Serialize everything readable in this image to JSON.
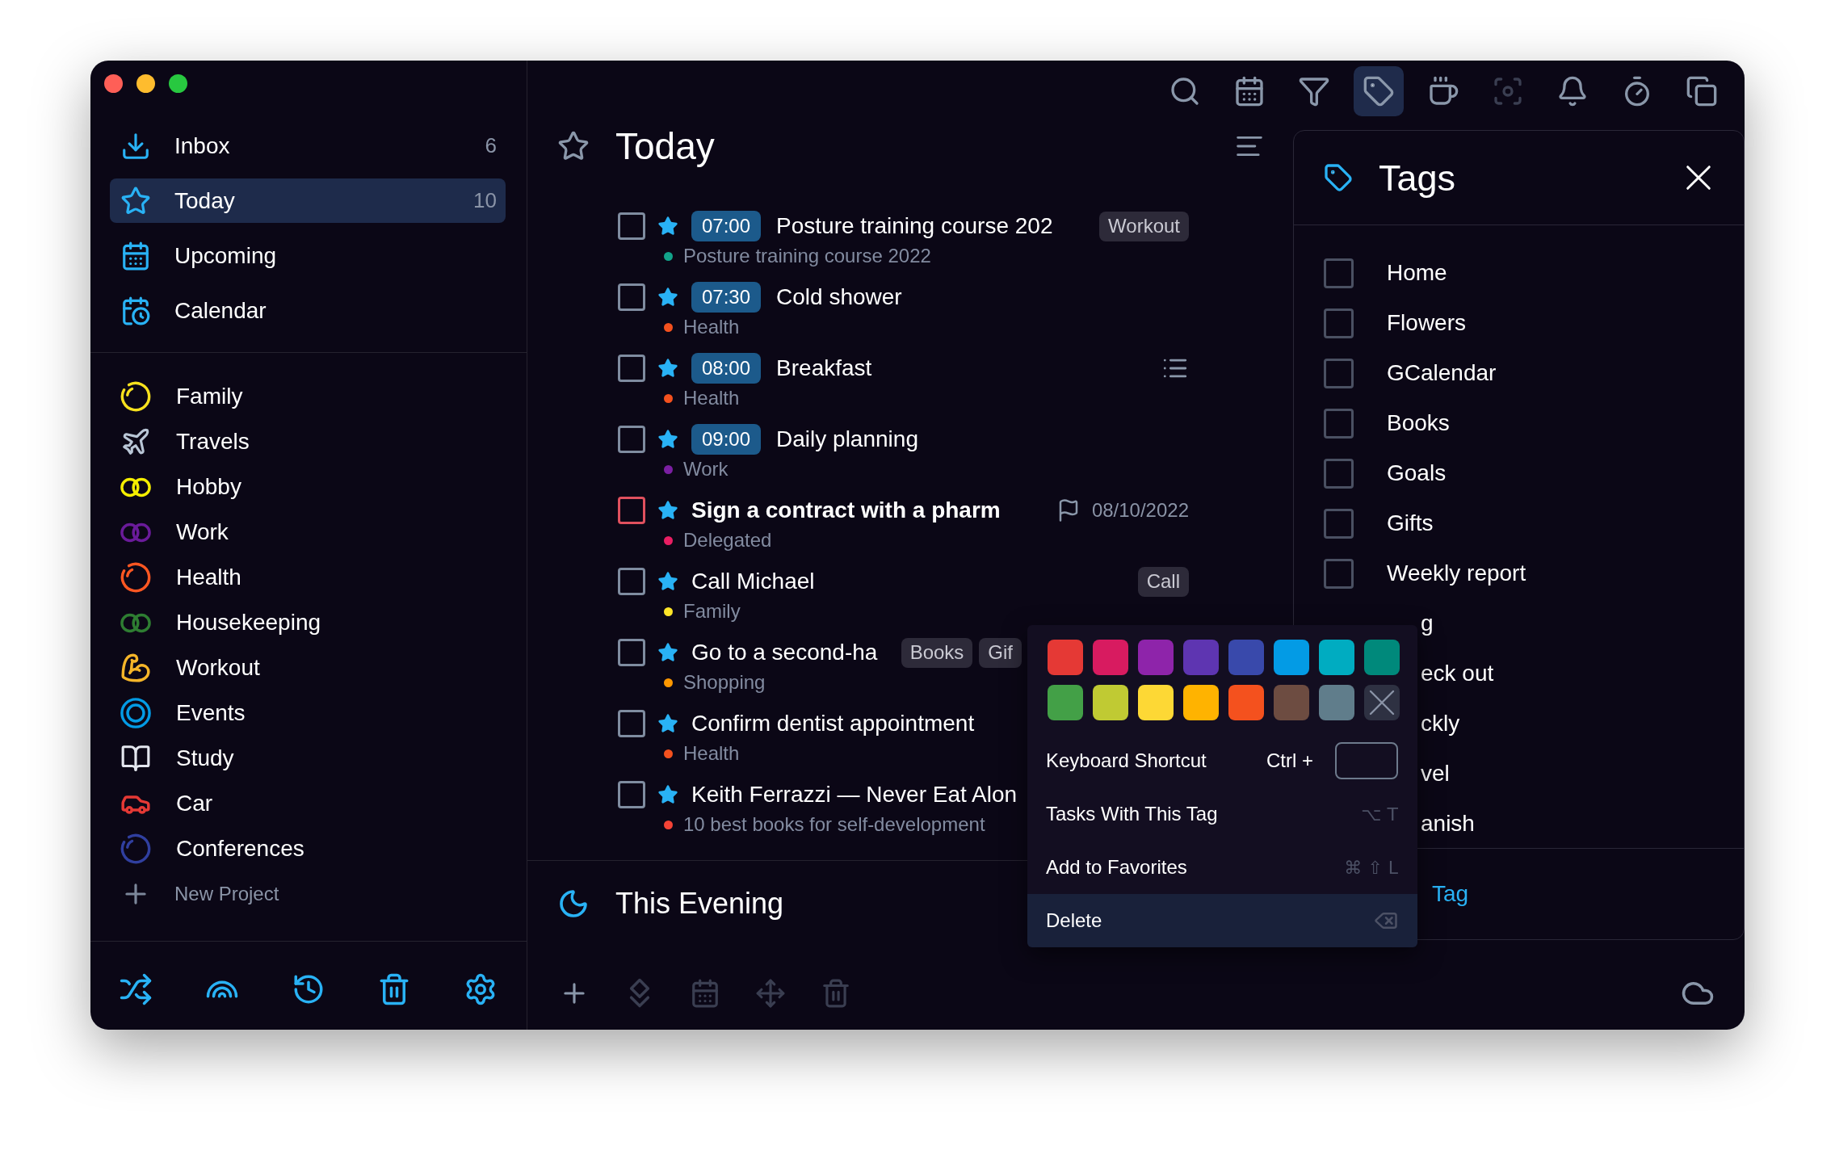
{
  "sidebar": {
    "nav": [
      {
        "label": "Inbox",
        "count": "6",
        "selected": false
      },
      {
        "label": "Today",
        "count": "10",
        "selected": true
      },
      {
        "label": "Upcoming",
        "selected": false
      },
      {
        "label": "Calendar",
        "selected": false
      }
    ],
    "projects": [
      {
        "label": "Family",
        "kind": "ring",
        "color": "#f7e11e"
      },
      {
        "label": "Travels",
        "kind": "plane"
      },
      {
        "label": "Hobby",
        "kind": "linked-rings",
        "color": "#f5ee00"
      },
      {
        "label": "Work",
        "kind": "linked-rings",
        "color": "#6a1b9a"
      },
      {
        "label": "Health",
        "kind": "ring",
        "color": "#ff5722"
      },
      {
        "label": "Housekeeping",
        "kind": "linked-rings",
        "color": "#2e7d32"
      },
      {
        "label": "Workout",
        "kind": "muscle"
      },
      {
        "label": "Events",
        "kind": "double-ring",
        "color": "#039be5"
      },
      {
        "label": "Study",
        "kind": "book"
      },
      {
        "label": "Car",
        "kind": "car"
      },
      {
        "label": "Conferences",
        "kind": "ring",
        "color": "#303f9f"
      }
    ],
    "new_project": "New Project"
  },
  "toolbar": [
    {
      "selected": false,
      "disabled": false
    },
    {
      "selected": false,
      "disabled": false
    },
    {
      "selected": false,
      "disabled": false
    },
    {
      "selected": true,
      "disabled": false
    },
    {
      "selected": false,
      "disabled": false
    },
    {
      "selected": false,
      "disabled": true
    },
    {
      "selected": false,
      "disabled": false
    },
    {
      "selected": false,
      "disabled": false
    },
    {
      "selected": false,
      "disabled": false
    }
  ],
  "today": {
    "title": "Today",
    "tasks": [
      {
        "checked": false,
        "priority": false,
        "time": "07:00",
        "title": "Posture training course 202",
        "project": "Posture training course 2022",
        "color": "#12a38a",
        "tags": [
          "Workout"
        ],
        "notes": false
      },
      {
        "checked": false,
        "priority": false,
        "time": "07:30",
        "title": "Cold shower",
        "project": "Health",
        "color": "#f4511e",
        "notes": false
      },
      {
        "checked": false,
        "priority": false,
        "time": "08:00",
        "title": "Breakfast",
        "project": "Health",
        "color": "#f4511e",
        "notes": true
      },
      {
        "checked": false,
        "priority": false,
        "time": "09:00",
        "title": "Daily planning",
        "project": "Work",
        "color": "#7b1fa2",
        "notes": false
      },
      {
        "checked": false,
        "priority": true,
        "title": "Sign a contract with a pharm",
        "due": "08/10/2022",
        "project": "Delegated",
        "color": "#e91e63",
        "notes": false
      },
      {
        "checked": false,
        "priority": false,
        "title": "Call Michael",
        "project": "Family",
        "color": "#fde428",
        "tags": [
          "Call"
        ],
        "notes": false
      },
      {
        "checked": false,
        "priority": false,
        "title": "Go to a second-ha",
        "project": "Shopping",
        "color": "#ff9800",
        "tags": [
          "Books",
          "Gif"
        ],
        "notes": false
      },
      {
        "checked": false,
        "priority": false,
        "title": "Confirm dentist appointment",
        "project": "Health",
        "color": "#f4511e",
        "notes": false
      },
      {
        "checked": false,
        "priority": false,
        "title": "Keith Ferrazzi — Never Eat Alon",
        "project": "10 best books for self-development",
        "color": "#f44336",
        "notes": false
      }
    ]
  },
  "evening": {
    "title": "This Evening"
  },
  "bottom_bar": [
    {
      "disabled": false
    },
    {
      "disabled": true
    },
    {
      "disabled": true
    },
    {
      "disabled": true
    },
    {
      "disabled": true
    }
  ],
  "tags_panel": {
    "title": "Tags",
    "items": [
      {
        "label": "Home",
        "checked": false
      },
      {
        "label": "Flowers",
        "checked": false
      },
      {
        "label": "GCalendar",
        "checked": false
      },
      {
        "label": "Books",
        "checked": false
      },
      {
        "label": "Goals",
        "checked": false
      },
      {
        "label": "Gifts",
        "checked": false
      },
      {
        "label": "Weekly report",
        "checked": false
      }
    ],
    "covered_items": [
      "g",
      "eck out",
      "ckly",
      "vel",
      "anish"
    ],
    "new_tag": "Tag"
  },
  "context_menu": {
    "swatches": [
      {
        "kind": "color",
        "color": "#e53935"
      },
      {
        "kind": "color",
        "color": "#d81b60"
      },
      {
        "kind": "color",
        "color": "#8e24aa"
      },
      {
        "kind": "color",
        "color": "#5e35b1"
      },
      {
        "kind": "color",
        "color": "#3949ab"
      },
      {
        "kind": "color",
        "color": "#039be5"
      },
      {
        "kind": "color",
        "color": "#00acc1"
      },
      {
        "kind": "color",
        "color": "#00897b"
      },
      {
        "kind": "color",
        "color": "#43a047"
      },
      {
        "kind": "color",
        "color": "#c0ca33"
      },
      {
        "kind": "color",
        "color": "#fdd835"
      },
      {
        "kind": "color",
        "color": "#ffb300"
      },
      {
        "kind": "color",
        "color": "#f4511e"
      },
      {
        "kind": "color",
        "color": "#6d4c41"
      },
      {
        "kind": "color",
        "color": "#607d8b"
      },
      {
        "kind": "none"
      }
    ],
    "items": [
      {
        "kind": "field",
        "label": "Keyboard Shortcut",
        "prefix": "Ctrl +",
        "selected": false
      },
      {
        "kind": "keys",
        "label": "Tasks With This Tag",
        "keys": "⌥ T",
        "selected": false
      },
      {
        "kind": "keys",
        "label": "Add to Favorites",
        "keys": "⌘ ⇧ L",
        "selected": false
      },
      {
        "kind": "backspace",
        "label": "Delete",
        "selected": true
      }
    ]
  }
}
